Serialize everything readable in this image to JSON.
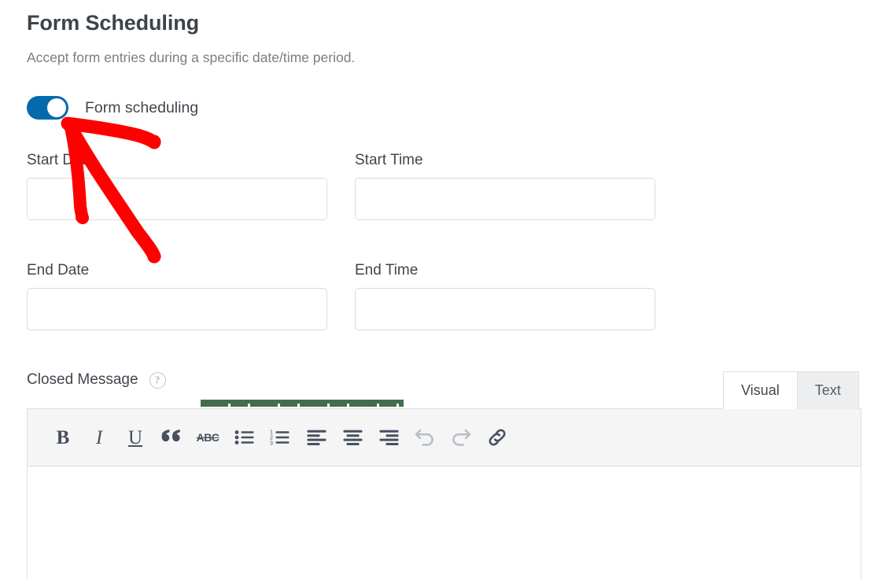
{
  "header": {
    "title": "Form Scheduling",
    "subtitle": "Accept form entries during a specific date/time period."
  },
  "toggle": {
    "label": "Form scheduling",
    "state": "on",
    "color_on": "#056aab",
    "knob_color": "#ffffff"
  },
  "fields": [
    {
      "key": "start_date",
      "label": "Start Date",
      "value": "",
      "placeholder": ""
    },
    {
      "key": "start_time",
      "label": "Start Time",
      "value": "",
      "placeholder": ""
    },
    {
      "key": "end_date",
      "label": "End Date",
      "value": "",
      "placeholder": ""
    },
    {
      "key": "end_time",
      "label": "End Time",
      "value": "",
      "placeholder": ""
    }
  ],
  "closed_message": {
    "label": "Closed Message",
    "help_icon": "question-mark-icon",
    "help_glyph": "?",
    "content": ""
  },
  "editor": {
    "tabs": [
      {
        "label": "Visual",
        "active": true
      },
      {
        "label": "Text",
        "active": false
      }
    ],
    "toolbar": [
      {
        "name": "bold",
        "glyph": "B",
        "disabled": false
      },
      {
        "name": "italic",
        "glyph": "I",
        "disabled": false
      },
      {
        "name": "underline",
        "glyph": "U",
        "disabled": false
      },
      {
        "name": "blockquote",
        "glyph": "“",
        "disabled": false
      },
      {
        "name": "strikethrough",
        "glyph": "ABC",
        "disabled": false
      },
      {
        "name": "bulleted-list",
        "glyph": "",
        "disabled": false
      },
      {
        "name": "numbered-list",
        "glyph": "",
        "disabled": false
      },
      {
        "name": "align-left",
        "glyph": "",
        "disabled": false
      },
      {
        "name": "align-center",
        "glyph": "",
        "disabled": false
      },
      {
        "name": "align-right",
        "glyph": "",
        "disabled": false
      },
      {
        "name": "undo",
        "glyph": "",
        "disabled": true
      },
      {
        "name": "redo",
        "glyph": "",
        "disabled": true
      },
      {
        "name": "insert-link",
        "glyph": "",
        "disabled": false
      }
    ]
  },
  "annotation": {
    "type": "arrow",
    "color": "#fe0000",
    "points_to": "form-scheduling-toggle"
  },
  "decor": {
    "green_bar_color": "#456c4e"
  }
}
